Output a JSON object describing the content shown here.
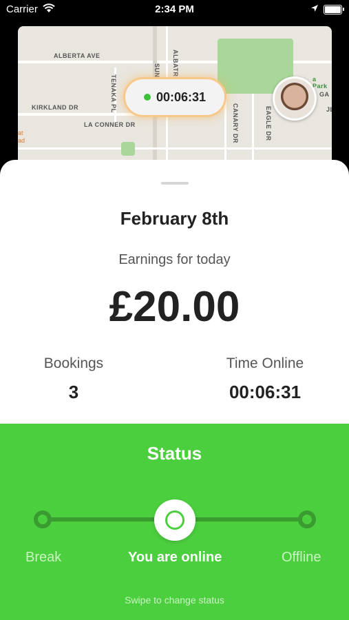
{
  "status_bar": {
    "carrier": "Carrier",
    "time": "2:34 PM"
  },
  "map": {
    "timer": "00:06:31",
    "streets": {
      "alberta": "ALBERTA AVE",
      "kirkland": "KIRKLAND DR",
      "la_conner": "LA CONNER DR",
      "tenaka": "TENAKA PL",
      "saratoga": "SUN SARATOGA",
      "albatross": "ALBATROSS",
      "canary": "CANARY DR",
      "eagle": "EAGLE DR",
      "park": "a Park",
      "ga": "GA",
      "jl": "JL",
      "at": "at",
      "ad": "ad"
    }
  },
  "summary": {
    "date": "February 8th",
    "earnings_label": "Earnings for today",
    "earnings": "£20.00",
    "bookings_label": "Bookings",
    "bookings": "3",
    "time_online_label": "Time Online",
    "time_online": "00:06:31"
  },
  "status": {
    "title": "Status",
    "options": {
      "break": "Break",
      "online": "You are online",
      "offline": "Offline"
    },
    "selected": "You are online",
    "hint": "Swipe to change status"
  },
  "colors": {
    "accent": "#4ccf3f",
    "track": "#3a9b30",
    "timer_glow": "#f7c88a"
  }
}
